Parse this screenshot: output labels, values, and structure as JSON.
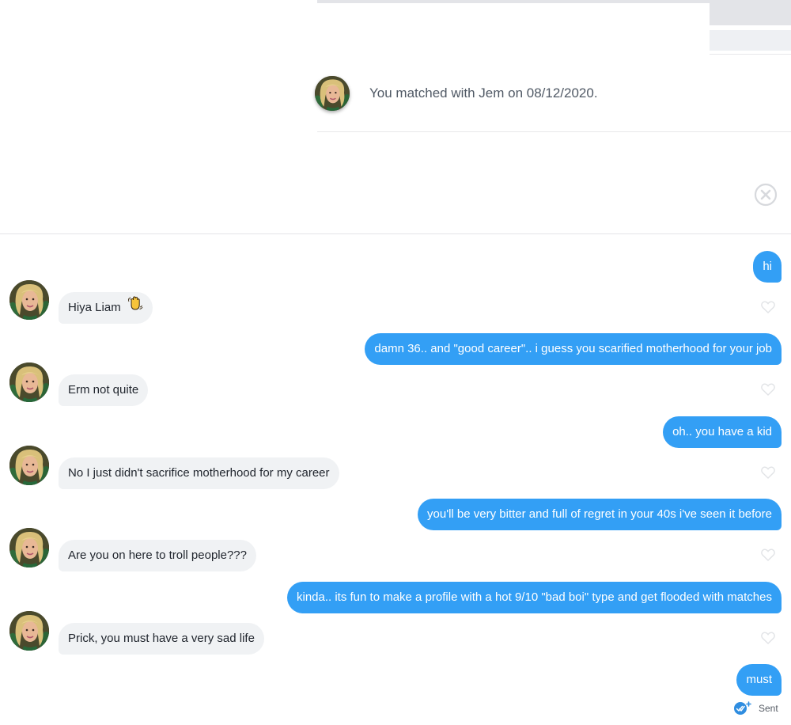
{
  "match_banner": {
    "text": "You matched with Jem on 08/12/2020."
  },
  "messages": [
    {
      "from": "me",
      "text": "hi"
    },
    {
      "from": "them",
      "text": "Hiya Liam"
    },
    {
      "from": "me",
      "text": "damn 36.. and \"good career\".. i guess you scarified motherhood for your job"
    },
    {
      "from": "them",
      "text": "Erm not quite"
    },
    {
      "from": "me",
      "text": "oh.. you have a kid"
    },
    {
      "from": "them",
      "text": "No I just didn't sacrifice motherhood for my career"
    },
    {
      "from": "me",
      "text": "you'll be very bitter and full of regret in your 40s i've seen it before"
    },
    {
      "from": "them",
      "text": "Are you on here to troll people???"
    },
    {
      "from": "me",
      "text": "kinda.. its fun to make a profile with a hot 9/10 \"bad boi\" type and get flooded with matches"
    },
    {
      "from": "them",
      "text": "Prick, you must have a very sad life"
    },
    {
      "from": "me",
      "text": "must"
    }
  ],
  "status": {
    "label": "Sent",
    "icon": "double-check-icon"
  },
  "icons": {
    "close": "close-circle-icon",
    "like": "heart-outline-icon",
    "wave": "waving-hand-emoji"
  },
  "colors": {
    "sent_bubble": "#339ff5",
    "received_bubble": "#f0f2f4",
    "sent_text": "#ffffff",
    "received_text": "#21262e"
  }
}
